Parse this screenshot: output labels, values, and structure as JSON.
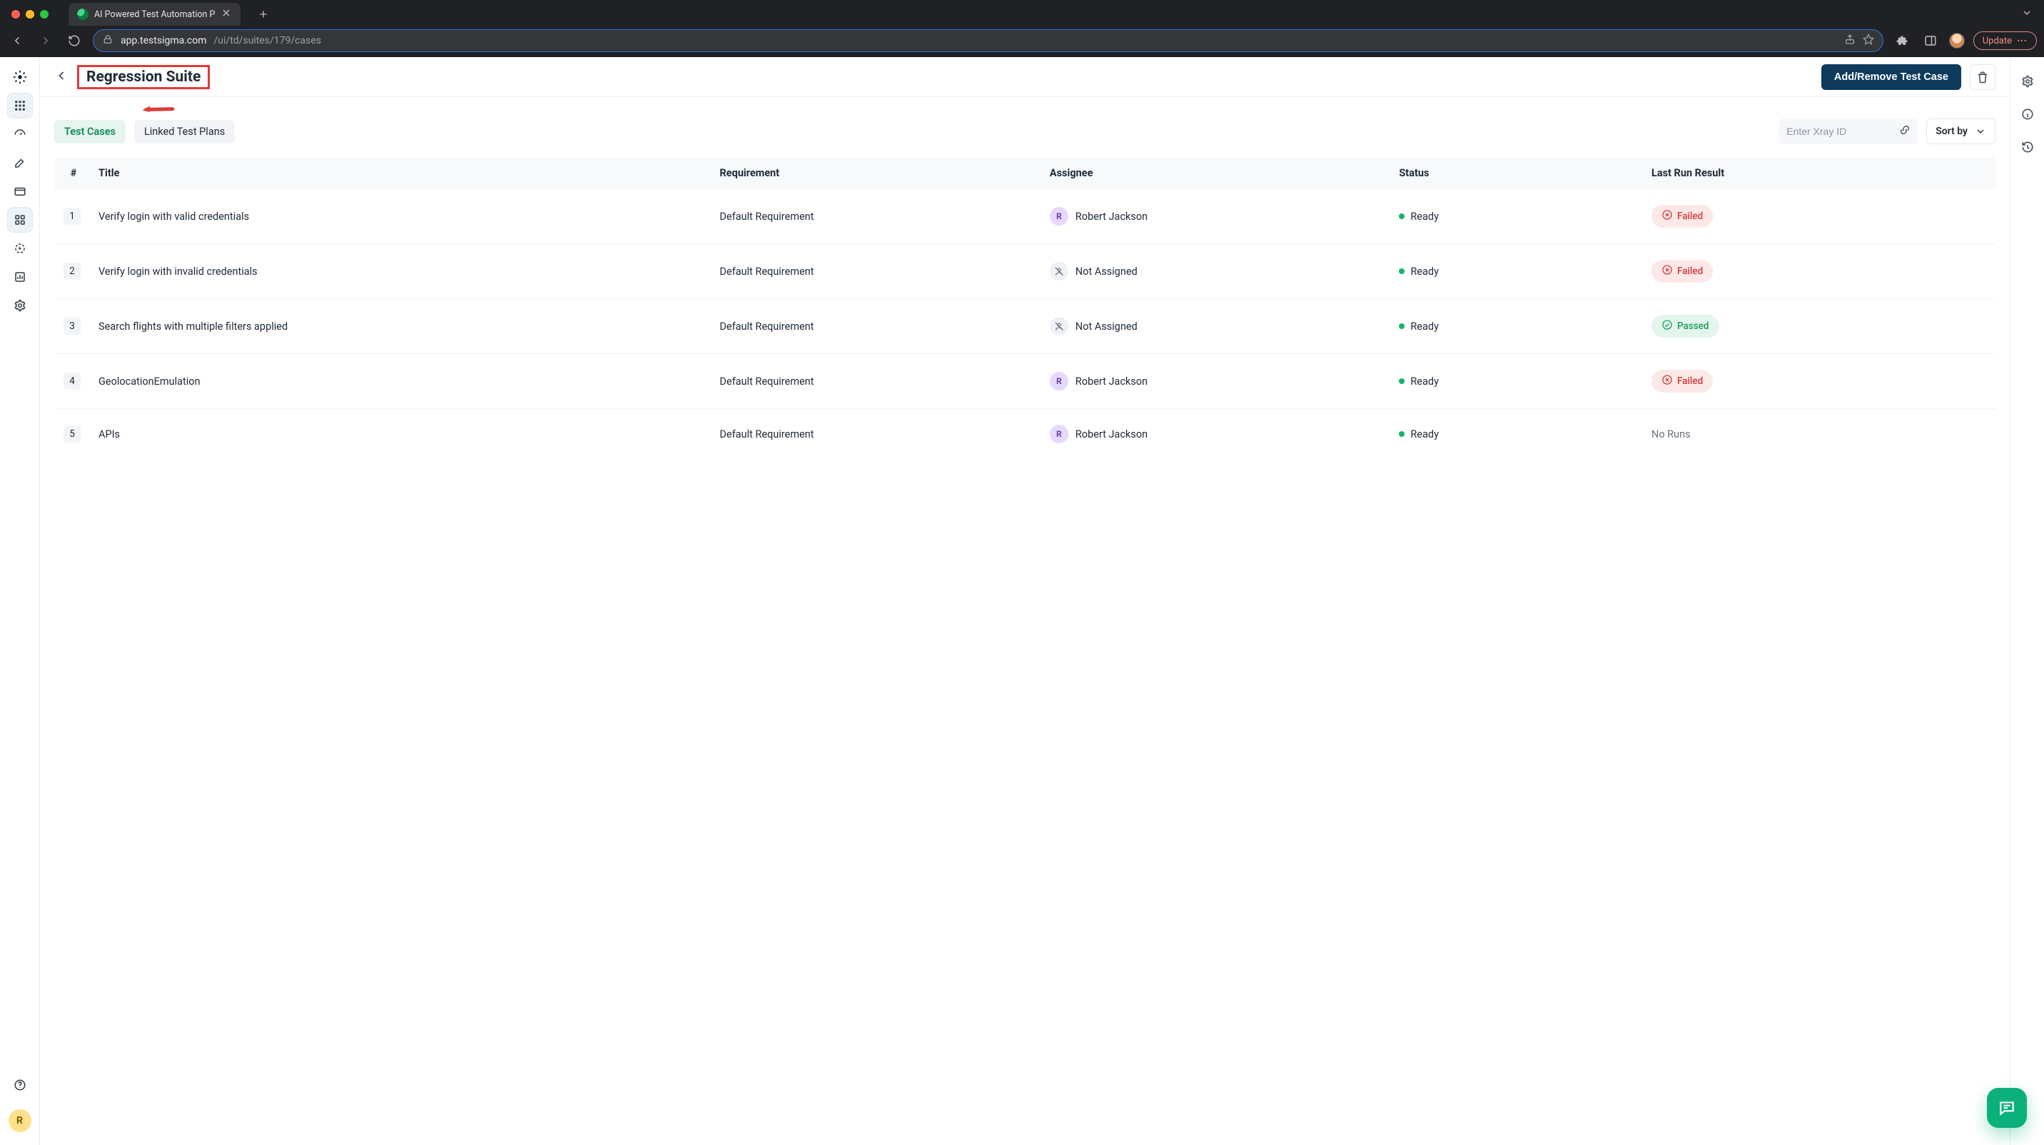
{
  "browser": {
    "tab_title": "AI Powered Test Automation P",
    "url_host": "app.testsigma.com",
    "url_path": "/ui/td/suites/179/cases",
    "update_label": "Update"
  },
  "left_rail": {
    "user_initial": "R"
  },
  "header": {
    "page_title": "Regression Suite",
    "primary_button": "Add/Remove Test Case"
  },
  "tabs": [
    {
      "id": "test-cases",
      "label": "Test Cases",
      "active": true
    },
    {
      "id": "linked-plans",
      "label": "Linked Test Plans",
      "active": false
    }
  ],
  "xray": {
    "placeholder": "Enter Xray ID"
  },
  "sort": {
    "label": "Sort by"
  },
  "columns": {
    "num": "#",
    "title": "Title",
    "requirement": "Requirement",
    "assignee": "Assignee",
    "status": "Status",
    "result": "Last Run Result"
  },
  "assignees": {
    "rjackson": {
      "name": "Robert Jackson",
      "initial": "R",
      "color": "purple"
    },
    "none": {
      "name": "Not Assigned"
    }
  },
  "status_labels": {
    "ready": "Ready"
  },
  "result_labels": {
    "failed": "Failed",
    "passed": "Passed",
    "none": "No Runs"
  },
  "rows": [
    {
      "n": "1",
      "title": "Verify login with valid credentials",
      "req": "Default Requirement",
      "assignee": "rjackson",
      "status": "ready",
      "result": "failed"
    },
    {
      "n": "2",
      "title": "Verify login with invalid credentials",
      "req": "Default Requirement",
      "assignee": "none",
      "status": "ready",
      "result": "failed"
    },
    {
      "n": "3",
      "title": "Search flights with multiple filters applied",
      "req": "Default Requirement",
      "assignee": "none",
      "status": "ready",
      "result": "passed"
    },
    {
      "n": "4",
      "title": "GeolocationEmulation",
      "req": "Default Requirement",
      "assignee": "rjackson",
      "status": "ready",
      "result": "failed"
    },
    {
      "n": "5",
      "title": "APIs",
      "req": "Default Requirement",
      "assignee": "rjackson",
      "status": "ready",
      "result": "none"
    }
  ]
}
